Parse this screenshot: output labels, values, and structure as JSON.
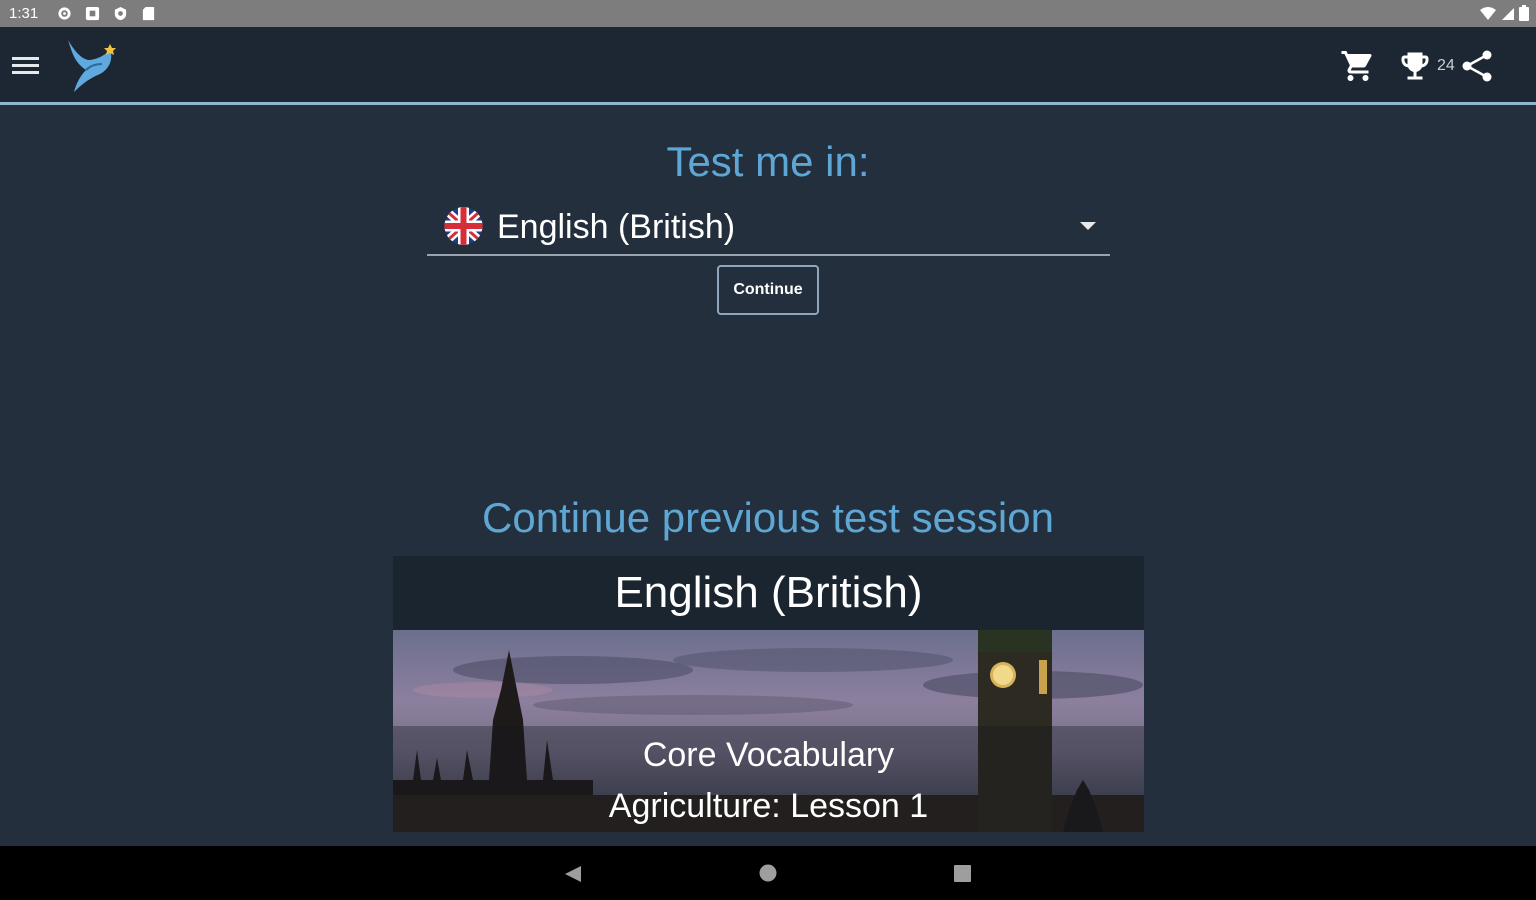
{
  "status_bar": {
    "time": "1:31",
    "left_icons": [
      "settings-icon",
      "notification-icon",
      "shield-icon",
      "sd-card-icon"
    ],
    "right_icons": [
      "wifi-icon",
      "signal-icon",
      "battery-icon"
    ]
  },
  "app_bar": {
    "icons": [
      "menu-icon",
      "bird-logo-icon",
      "cart-icon",
      "trophy-icon",
      "share-icon"
    ],
    "trophy_count": "24"
  },
  "test_section": {
    "heading": "Test me in:",
    "selected_language": "English (British)",
    "flag": "uk-flag-icon",
    "continue_label": "Continue"
  },
  "previous_session": {
    "heading": "Continue previous test session",
    "language": "English (British)",
    "category": "Core Vocabulary",
    "lesson": "Agriculture: Lesson 1"
  },
  "nav_bar": {
    "icons": [
      "back-icon",
      "home-icon",
      "recents-icon"
    ]
  },
  "colors": {
    "background": "#232f3c",
    "app_bar": "#1d2733",
    "accent": "#5ea6d4",
    "status_bar": "#7d7d7d"
  }
}
